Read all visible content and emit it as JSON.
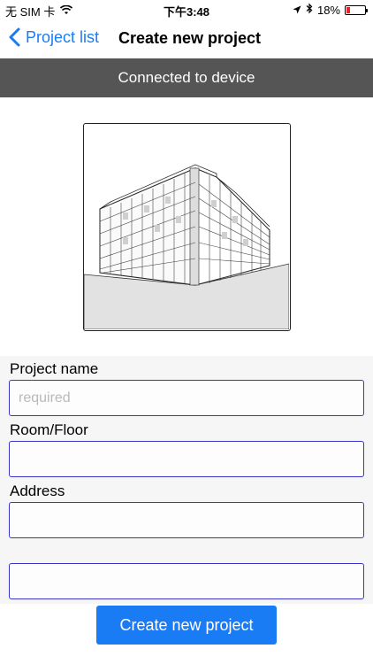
{
  "status_bar": {
    "carrier": "无 SIM 卡",
    "time": "下午3:48",
    "battery_percent": "18%",
    "battery_level": 0.18
  },
  "nav": {
    "back_label": "Project list",
    "title": "Create new project"
  },
  "banner": {
    "text": "Connected to device"
  },
  "form": {
    "project_name_label": "Project name",
    "project_name_placeholder": "required",
    "room_floor_label": "Room/Floor",
    "address_label": "Address"
  },
  "create_button_label": "Create new project",
  "colors": {
    "accent": "#1a7cf5",
    "banner": "#555555",
    "input_border": "#3b34c9"
  }
}
